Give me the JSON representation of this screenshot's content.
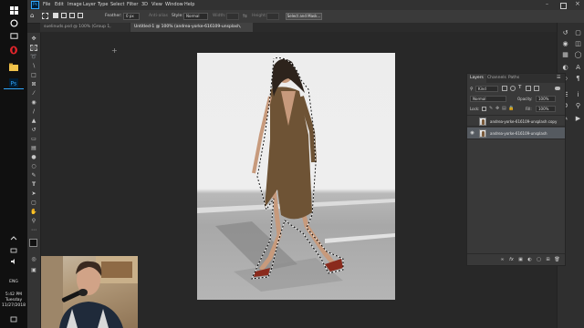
{
  "taskbar": {
    "time": "5:42 PM",
    "day": "Tuesday",
    "date": "11/27/2018",
    "language": "ENG"
  },
  "menu": [
    "File",
    "Edit",
    "Image",
    "Layer",
    "Type",
    "Select",
    "Filter",
    "3D",
    "View",
    "Window",
    "Help"
  ],
  "ps_logo": "Ps",
  "options": {
    "feather_label": "Feather:",
    "feather_value": "0 px",
    "anti_alias_label": "Anti-alias",
    "style_label": "Style:",
    "style_value": "Normal",
    "width_label": "Width:",
    "height_label": "Height:",
    "select_mask_button": "Select and Mask..."
  },
  "tabs": [
    {
      "label": "suelinuds.psd @ 100% (Group 1, RGB/8) *",
      "active": false
    },
    {
      "label": "Untitled-1 @ 100% (andrea-yorke-616109-unsplash, RGB/8#) *",
      "active": true
    }
  ],
  "layers_panel": {
    "tabs": [
      "Layers",
      "Channels",
      "Paths"
    ],
    "kind_filter": "Kind",
    "blend_mode": "Normal",
    "opacity_label": "Opacity:",
    "opacity_value": "100%",
    "lock_label": "Lock:",
    "fill_label": "Fill:",
    "fill_value": "100%",
    "layers": [
      {
        "name": "andrea-yorke-616109-unsplash copy",
        "selected": false,
        "visible": false
      },
      {
        "name": "andrea-yorke-616109-unsplash",
        "selected": true,
        "visible": true
      }
    ]
  },
  "colors": {
    "ps_blue": "#31a8ff",
    "dress_brown": "#6e5335",
    "heel_red": "#8a2a1c"
  }
}
